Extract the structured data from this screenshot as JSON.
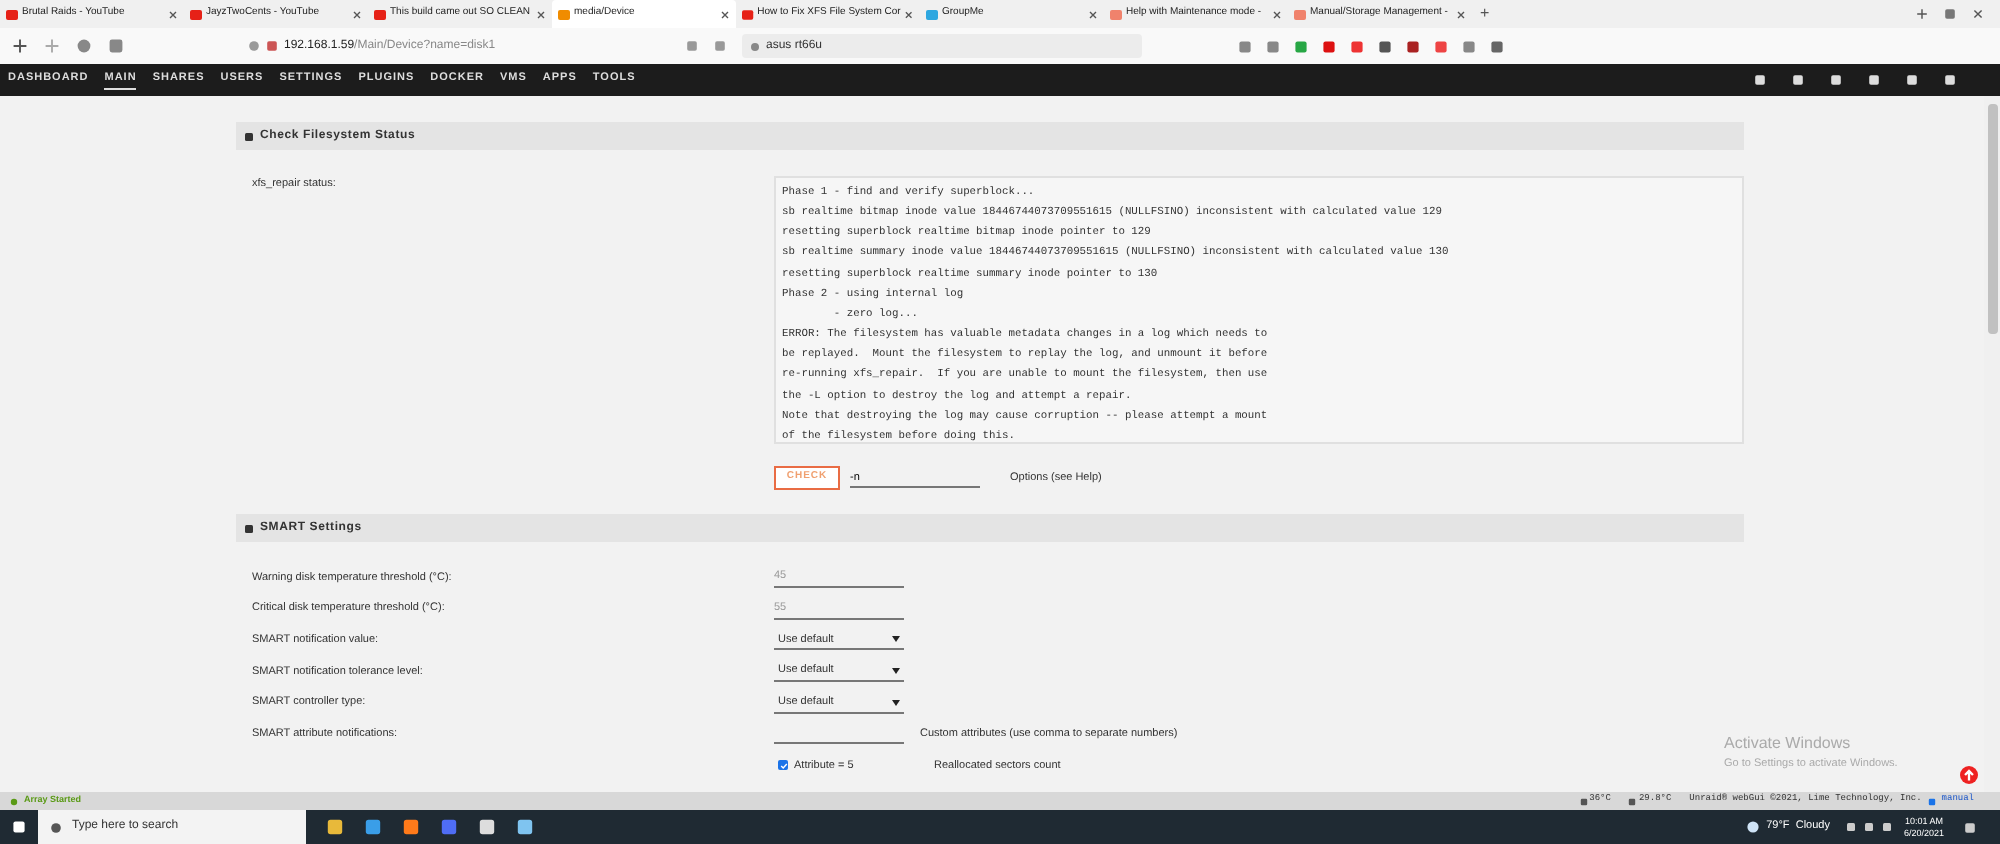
{
  "browser": {
    "tabs": [
      {
        "title": "Brutal Raids - YouTube",
        "selected": false,
        "color": "#e62117"
      },
      {
        "title": "JayzTwoCents - YouTube",
        "selected": false,
        "color": "#e62117"
      },
      {
        "title": "This build came out SO CLEAN",
        "selected": false,
        "color": "#e62117"
      },
      {
        "title": "media/Device",
        "selected": true,
        "color": "#f08c00"
      },
      {
        "title": "How to Fix XFS File System Cor",
        "selected": false,
        "color": "#e62117"
      },
      {
        "title": "GroupMe",
        "selected": false,
        "color": "#2ea7e0"
      },
      {
        "title": "Help with Maintenance mode -",
        "selected": false,
        "color": "#f0826c"
      },
      {
        "title": "Manual/Storage Management -",
        "selected": false,
        "color": "#f0826c"
      }
    ],
    "new_tab": "+",
    "url_host": "192.168.1.59",
    "url_path": "/Main/Device?name=disk1",
    "search": "asus rt66u"
  },
  "nav": {
    "items": [
      {
        "label": "DASHBOARD",
        "selected": false
      },
      {
        "label": "MAIN",
        "selected": true
      },
      {
        "label": "SHARES",
        "selected": false
      },
      {
        "label": "USERS",
        "selected": false
      },
      {
        "label": "SETTINGS",
        "selected": false
      },
      {
        "label": "PLUGINS",
        "selected": false
      },
      {
        "label": "DOCKER",
        "selected": false
      },
      {
        "label": "VMS",
        "selected": false
      },
      {
        "label": "APPS",
        "selected": false
      },
      {
        "label": "TOOLS",
        "selected": false
      }
    ]
  },
  "check_section": {
    "title": "Check Filesystem Status",
    "label": "xfs_repair status:",
    "output": [
      "Phase 1 - find and verify superblock...",
      "sb realtime bitmap inode value 18446744073709551615 (NULLFSINO) inconsistent with calculated value 129",
      "resetting superblock realtime bitmap inode pointer to 129",
      "sb realtime summary inode value 18446744073709551615 (NULLFSINO) inconsistent with calculated value 130",
      "resetting superblock realtime summary inode pointer to 130",
      "Phase 2 - using internal log",
      "        - zero log...",
      "ERROR: The filesystem has valuable metadata changes in a log which needs to",
      "be replayed.  Mount the filesystem to replay the log, and unmount it before",
      "re-running xfs_repair.  If you are unable to mount the filesystem, then use",
      "the -L option to destroy the log and attempt a repair.",
      "Note that destroying the log may cause corruption -- please attempt a mount",
      "of the filesystem before doing this."
    ],
    "button": "CHECK",
    "options_value": "-n",
    "options_hint": "Options (see Help)"
  },
  "smart_section": {
    "title": "SMART Settings",
    "rows": [
      {
        "kind": "input",
        "label": "Warning disk temperature threshold (°C):",
        "placeholder": "45"
      },
      {
        "kind": "input",
        "label": "Critical disk temperature threshold (°C):",
        "placeholder": "55"
      },
      {
        "kind": "select",
        "label": "SMART notification value:",
        "value": "Use default"
      },
      {
        "kind": "select",
        "label": "SMART notification tolerance level:",
        "value": "Use default"
      },
      {
        "kind": "select",
        "label": "SMART controller type:",
        "value": "Use default"
      },
      {
        "kind": "attributes",
        "label": "SMART attribute notifications:",
        "hint": "Custom attributes (use comma to separate numbers)"
      }
    ],
    "attributes": [
      {
        "label": "Attribute = 5",
        "description": "Reallocated sectors count",
        "checked": true
      }
    ]
  },
  "status_bar": {
    "status": "Array Started",
    "temps": [
      "36°C",
      "29.8°C"
    ],
    "copyright": "Unraid® webGui ©2021, Lime Technology, Inc.",
    "link": "manual"
  },
  "activation": {
    "title": "Activate Windows",
    "subtitle": "Go to Settings to activate Windows."
  },
  "taskbar": {
    "search_placeholder": "Type here to search",
    "weather": "79°F  Cloudy",
    "time": "10:01 AM",
    "date": "6/20/2021"
  }
}
